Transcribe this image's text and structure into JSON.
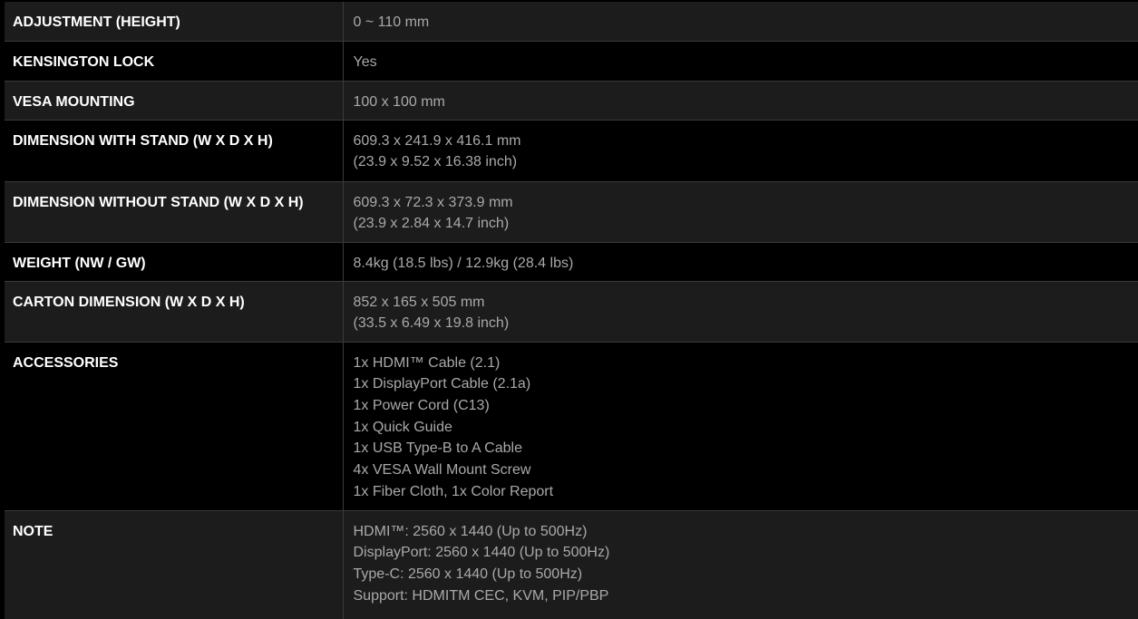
{
  "specs": [
    {
      "label": "ADJUSTMENT (HEIGHT)",
      "lines": [
        "0 ~ 110 mm"
      ]
    },
    {
      "label": "KENSINGTON LOCK",
      "lines": [
        "Yes"
      ]
    },
    {
      "label": "VESA MOUNTING",
      "lines": [
        "100 x 100 mm"
      ]
    },
    {
      "label": "DIMENSION WITH STAND (W X D X H)",
      "lines": [
        "609.3 x 241.9 x 416.1 mm",
        "(23.9 x 9.52 x 16.38 inch)"
      ]
    },
    {
      "label": "DIMENSION WITHOUT STAND (W X D X H)",
      "lines": [
        "609.3 x 72.3 x 373.9 mm",
        "(23.9 x 2.84 x 14.7 inch)"
      ]
    },
    {
      "label": "WEIGHT (NW / GW)",
      "lines": [
        "8.4kg (18.5 lbs) / 12.9kg (28.4 lbs)"
      ]
    },
    {
      "label": "CARTON DIMENSION (W X D X H)",
      "lines": [
        "852 x 165 x 505 mm",
        "(33.5 x 6.49 x 19.8 inch)"
      ]
    },
    {
      "label": "ACCESSORIES",
      "lines": [
        "1x HDMI™ Cable (2.1)",
        "1x DisplayPort Cable (2.1a)",
        "1x Power Cord (C13)",
        "1x Quick Guide",
        "1x USB Type-B to A Cable",
        "4x VESA Wall Mount Screw",
        "1x Fiber Cloth, 1x Color Report"
      ]
    },
    {
      "label": "NOTE",
      "lines": [
        "HDMI™: 2560 x 1440 (Up to 500Hz)",
        "DisplayPort: 2560 x 1440 (Up to 500Hz)",
        "Type-C: 2560 x 1440 (Up to 500Hz)",
        "Support: HDMITM CEC, KVM, PIP/PBP"
      ]
    }
  ]
}
